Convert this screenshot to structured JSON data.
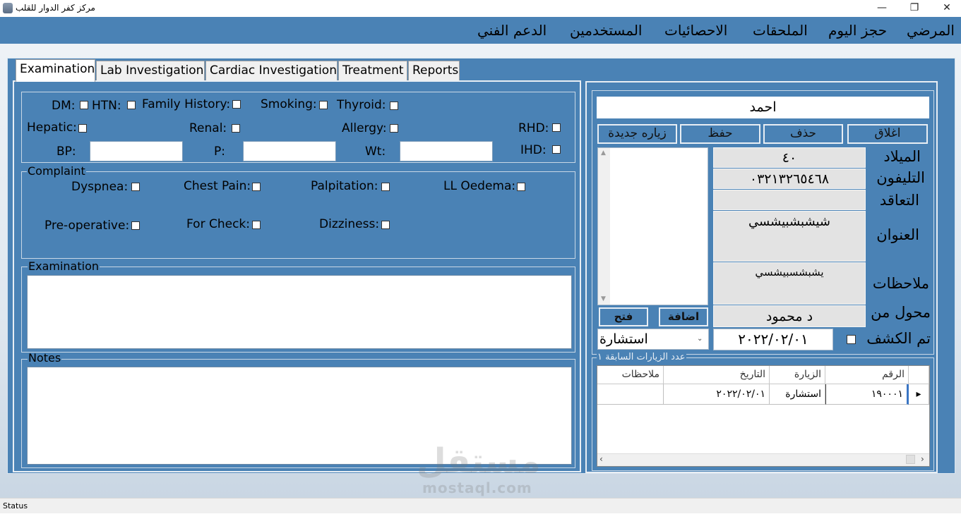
{
  "window": {
    "title": "مركز كفر الدوار للقلب",
    "minimize_glyph": "—",
    "restore_glyph": "❐",
    "close_glyph": "✕"
  },
  "menu": [
    "المرضي",
    "حجز اليوم",
    "الملحقات",
    "الاحصائيات",
    "المستخدمين",
    "الدعم الفني"
  ],
  "tabs": [
    "Examination",
    "Lab Investigation",
    "Cardiac Investigation",
    "Treatment",
    "Reports"
  ],
  "history": {
    "dm": "DM:",
    "htn": "HTN:",
    "family_history": "Family History:",
    "smoking": "Smoking:",
    "thyroid": "Thyroid:",
    "hepatic": "Hepatic:",
    "renal": "Renal:",
    "allergy": "Allergy:",
    "rhd": "RHD:",
    "bp": "BP:",
    "p": "P:",
    "wt": "Wt:",
    "ihd": "IHD:"
  },
  "complaint": {
    "title": "Complaint",
    "dyspnea": "Dyspnea:",
    "chest_pain": "Chest Pain:",
    "palpitation": "Palpitation:",
    "ll_oedema": "LL Oedema:",
    "pre_operative": "Pre-operative:",
    "for_check": "For Check:",
    "dizziness": "Dizziness:"
  },
  "examination": {
    "title": "Examination"
  },
  "notes": {
    "title": "Notes"
  },
  "patient": {
    "name": "احمد",
    "buttons": {
      "close": "اغلاق",
      "delete": "حذف",
      "save": "حفظ",
      "new_visit": "زياره جديدة"
    },
    "labels": {
      "birth": "الميلاد",
      "phone": "التليفون",
      "contract": "التعاقد",
      "address": "العنوان",
      "notes": "ملاحظات",
      "referred_by": "محول من",
      "examined": "تم الكشف"
    },
    "values": {
      "birth": "٤٠",
      "phone": "٠٣٢١٣٢٦٥٤٦٨",
      "contract": "",
      "address": "شيشبشبيشسي",
      "notes": "يشبشسبيشسي",
      "referred_by": "د محمود"
    },
    "add_button": "اضافة",
    "open_button": "فتح",
    "visit_type": "استشارة",
    "visit_date": "٢٠٢٢/٠٢/٠١"
  },
  "visits": {
    "title": "عدد الزيارات السابقة ١",
    "columns": [
      "الرقم",
      "الزيارة",
      "التاريخ",
      "ملاحظات"
    ],
    "rows": [
      {
        "number": "١٩٠٠٠١",
        "visit": "استشارة",
        "date": "٢٠٢٢/٠٢/٠١",
        "notes": ""
      }
    ]
  },
  "status": "Status",
  "watermark": {
    "main": "مستقل",
    "sub": "mostaql.com"
  },
  "colors": {
    "panel": "#4a82b5",
    "field": "#e3e3e3"
  }
}
